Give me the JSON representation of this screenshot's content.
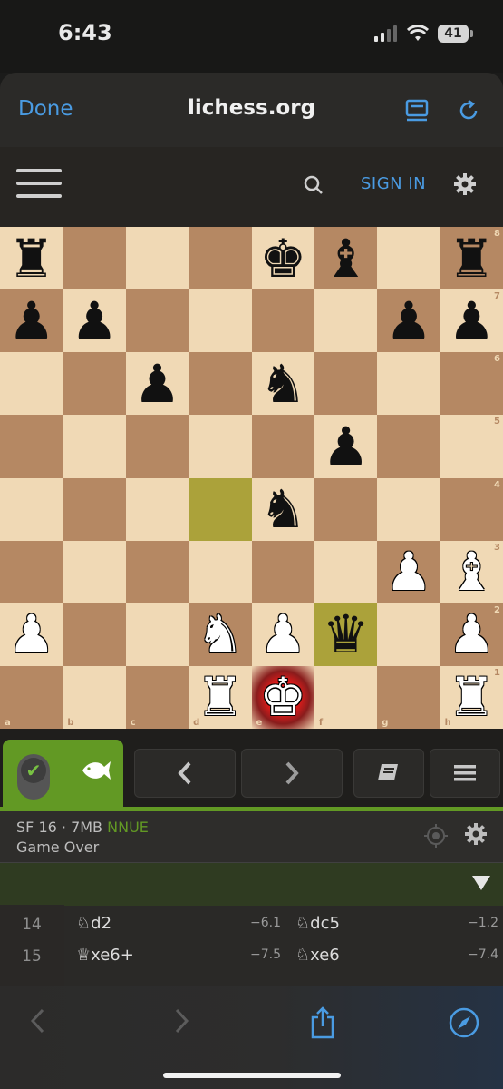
{
  "status": {
    "time": "6:43",
    "battery": "41"
  },
  "nav": {
    "done": "Done",
    "title": "lichess.org"
  },
  "header": {
    "signin": "SIGN IN"
  },
  "board": {
    "files": [
      "a",
      "b",
      "c",
      "d",
      "e",
      "f",
      "g",
      "h"
    ],
    "ranks": [
      "8",
      "7",
      "6",
      "5",
      "4",
      "3",
      "2",
      "1"
    ],
    "rows": [
      [
        "br",
        "",
        "",
        "",
        "bk",
        "bb",
        "",
        "br"
      ],
      [
        "bp",
        "bp",
        "",
        "",
        "",
        "",
        "bp",
        "bp"
      ],
      [
        "",
        "",
        "bp",
        "",
        "bn",
        "",
        "",
        ""
      ],
      [
        "",
        "",
        "",
        "",
        "",
        "bp",
        "",
        ""
      ],
      [
        "",
        "",
        "",
        "",
        "bn",
        "",
        "",
        ""
      ],
      [
        "",
        "",
        "",
        "",
        "",
        "",
        "wp",
        "wb"
      ],
      [
        "wp",
        "",
        "",
        "wn",
        "wp",
        "bq",
        "",
        "wp"
      ],
      [
        "",
        "",
        "",
        "wr",
        "wk",
        "",
        "",
        "wr"
      ]
    ],
    "highlight": [
      "d4",
      "f2"
    ],
    "check": "e1"
  },
  "engine": {
    "name": "SF 16 · 7MB",
    "nnue": "NNUE",
    "status": "Game Over"
  },
  "moves": [
    {
      "num": "14",
      "white": "♘d2",
      "white_eval": "−6.1",
      "black": "♘dc5",
      "black_eval": "−1.2"
    },
    {
      "num": "15",
      "white": "♕xe6+",
      "white_eval": "−7.5",
      "black": "♘xe6",
      "black_eval": "−7.4"
    }
  ]
}
